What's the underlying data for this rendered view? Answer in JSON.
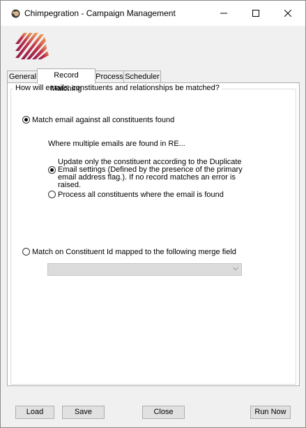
{
  "window": {
    "title": "Chimpegration - Campaign Management"
  },
  "tabs": [
    {
      "label": "General"
    },
    {
      "label": "Record Matching"
    },
    {
      "label": "Process"
    },
    {
      "label": "Scheduler"
    }
  ],
  "matching": {
    "group_label": "How will emails, constituents and relationships be matched?",
    "option_all": "Match email against all constituents found",
    "multiple_note": "Where multiple emails are found in RE...",
    "sub_option_update": "Update only the constituent according to the Duplicate Email settings (Defined by the presence of the primary email address flag.).  If no record matches an error is raised.",
    "sub_option_process_all": "Process all constituents where the email is found",
    "option_constituent_id": "Match on Constituent Id mapped to the following merge field",
    "merge_field_value": ""
  },
  "footer": {
    "load": "Load",
    "save": "Save",
    "close": "Close",
    "run_now": "Run Now"
  },
  "icons": {
    "app": "chimpegration-icon",
    "logo": "zylo-logo"
  },
  "colors": {
    "logo_gradient_start": "#f2a65a",
    "logo_gradient_end": "#8b1c4a"
  }
}
